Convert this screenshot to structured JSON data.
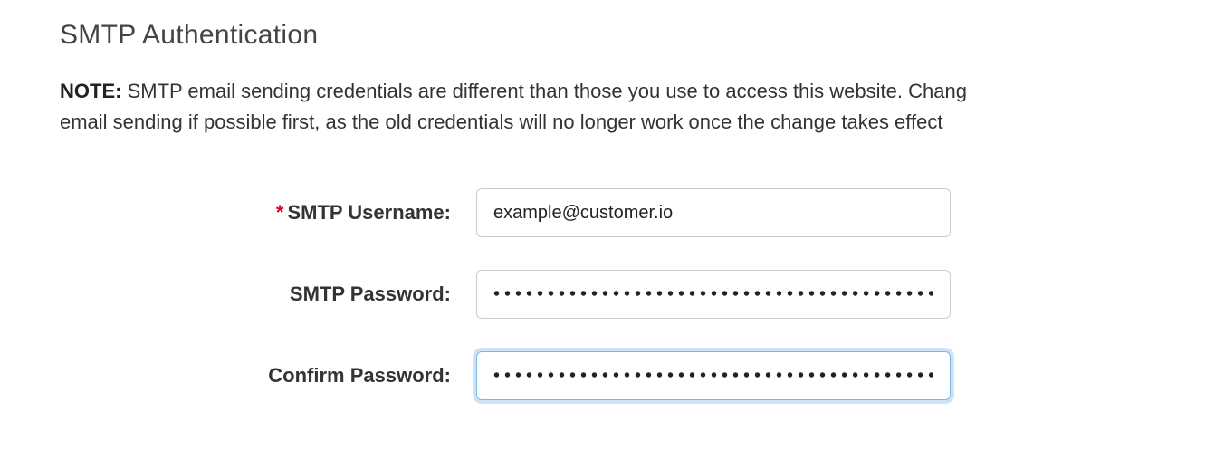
{
  "section": {
    "title": "SMTP Authentication"
  },
  "note": {
    "label": "NOTE:",
    "line1": " SMTP email sending credentials are different than those you use to access this website. Chang",
    "line2": "email sending if possible first, as the old credentials will no longer work once the change takes effect"
  },
  "fields": {
    "username": {
      "required_mark": "*",
      "label": "SMTP Username:",
      "value": "example@customer.io"
    },
    "password": {
      "label": "SMTP Password:",
      "value": "••••••••••••••••••••••••••••••••••••••••••••"
    },
    "confirm": {
      "label": "Confirm Password:",
      "value": "•••••••••••••••••••••••••••••••••••••••••••"
    }
  }
}
